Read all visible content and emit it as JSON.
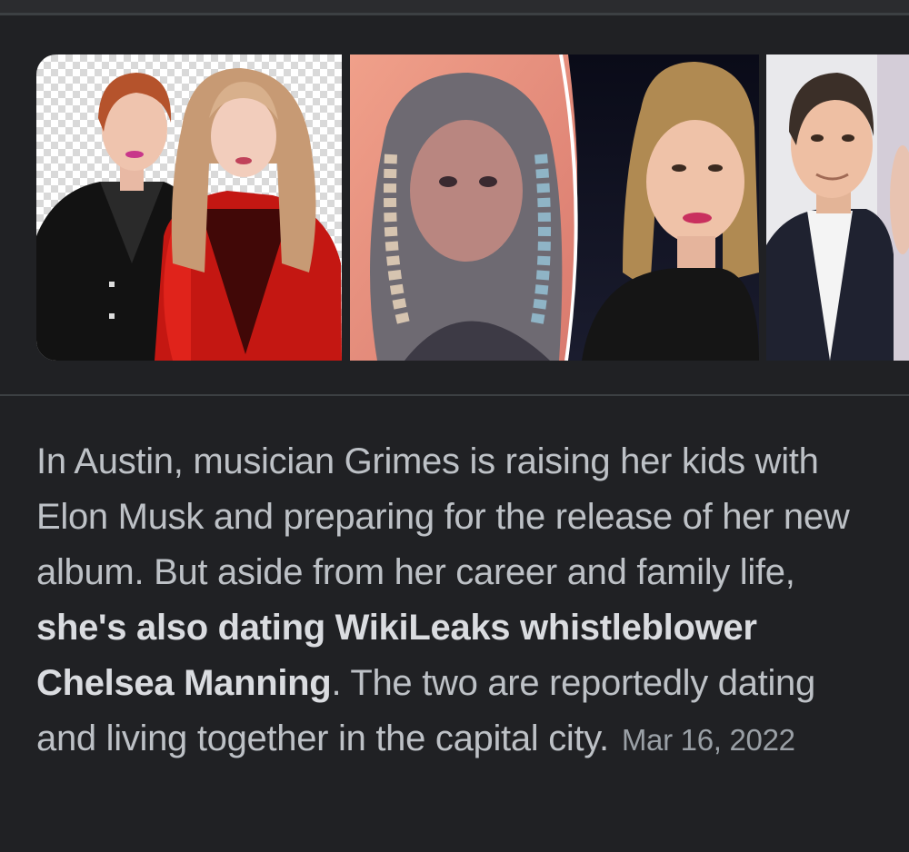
{
  "snippet": {
    "text_before": "In Austin, musician Grimes is raising her kids with Elon Musk and preparing for the release of her new album. But aside from her career and family life, ",
    "text_bold": "she's also dating WikiLeaks whistleblower Chelsea Manning",
    "text_after": ". The two are reportedly dating and living together in the capital city.",
    "date": "Mar 16, 2022"
  },
  "colors": {
    "background": "#202124",
    "snippet_text": "#bdc1c6",
    "bold_text": "#dadce0",
    "date_text": "#9aa0a6",
    "divider": "#3c4043"
  }
}
